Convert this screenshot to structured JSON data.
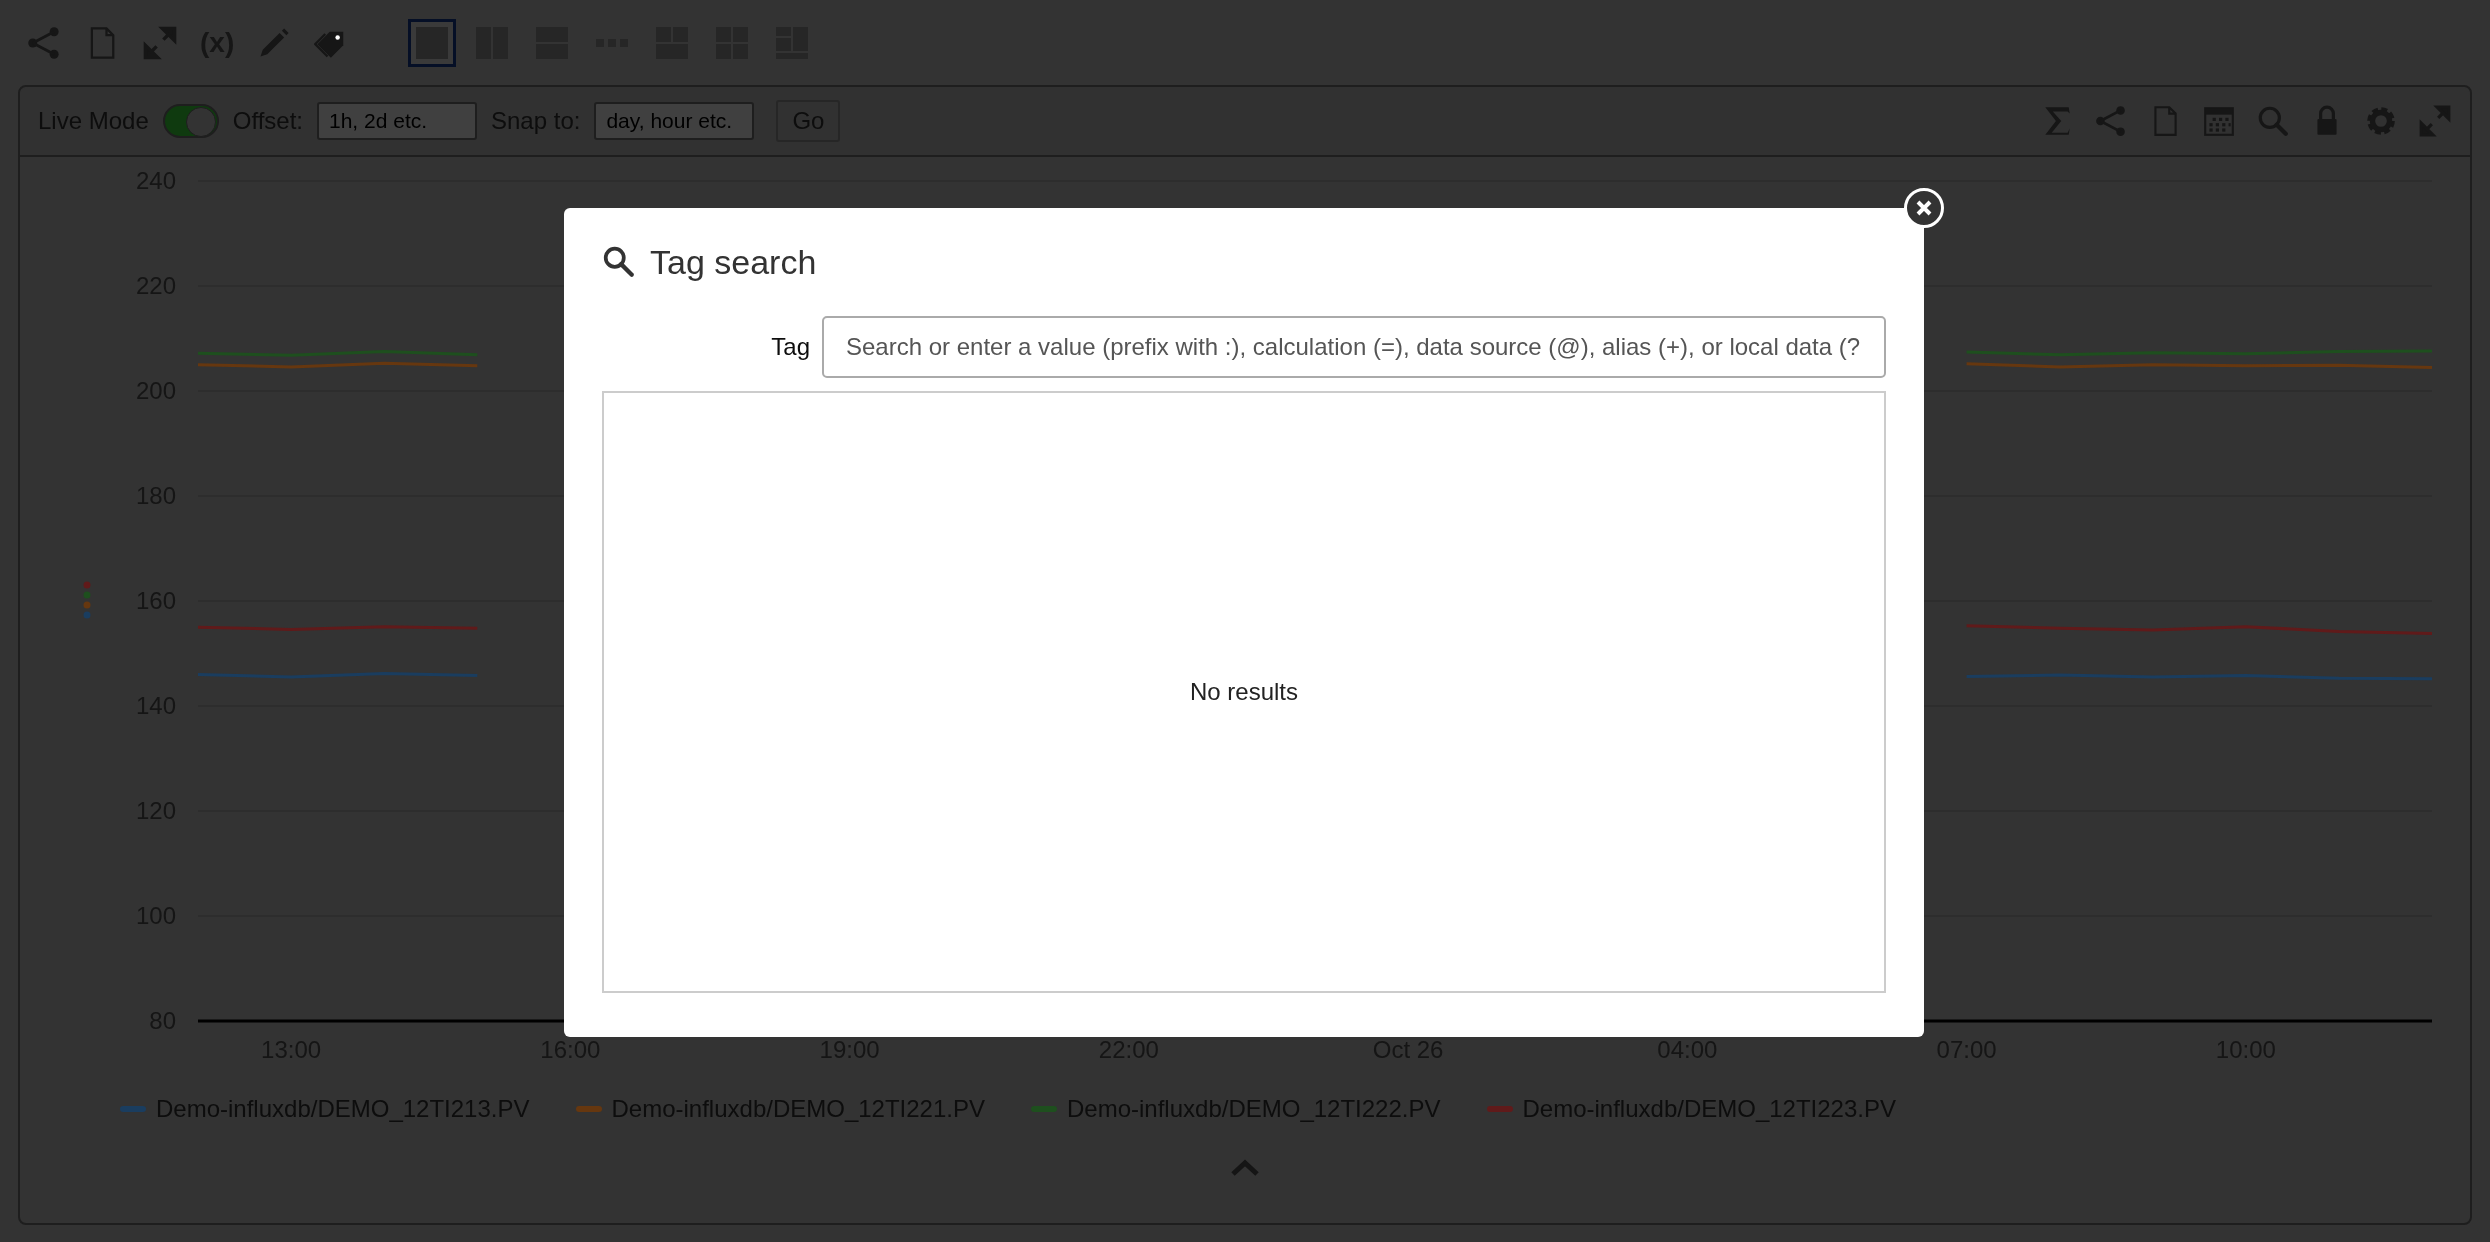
{
  "toolbar": {
    "actions": [
      {
        "kind": "share"
      },
      {
        "kind": "file"
      },
      {
        "kind": "expand"
      },
      {
        "kind": "text",
        "label": "(x)"
      },
      {
        "kind": "pencil"
      },
      {
        "kind": "tags"
      }
    ],
    "layouts": [
      {
        "kind": "single",
        "selected": true
      },
      {
        "kind": "two-columns",
        "selected": false
      },
      {
        "kind": "two-rows",
        "selected": false
      },
      {
        "kind": "many",
        "selected": false
      },
      {
        "kind": "two-top-one-bottom",
        "selected": false
      },
      {
        "kind": "grid",
        "selected": false
      },
      {
        "kind": "mixed",
        "selected": false
      }
    ]
  },
  "panel": {
    "header": {
      "live_mode_label": "Live Mode",
      "live_mode_on": true,
      "offset_label": "Offset:",
      "offset_placeholder": "1h, 2d etc.",
      "snap_label": "Snap to:",
      "snap_placeholder": "day, hour etc.",
      "go_button": "Go",
      "tools": [
        {
          "kind": "sum"
        },
        {
          "kind": "share"
        },
        {
          "kind": "file"
        },
        {
          "kind": "calendar"
        },
        {
          "kind": "search"
        },
        {
          "kind": "lock"
        },
        {
          "kind": "gear"
        },
        {
          "kind": "expand"
        }
      ]
    },
    "chart_data": {
      "type": "line",
      "categories": [
        null,
        "13:00",
        null,
        null,
        "16:00",
        null,
        null,
        "19:00",
        null,
        null,
        "22:00",
        null,
        null,
        "Oct 26",
        null,
        null,
        "04:00",
        null,
        null,
        "07:00",
        null,
        null,
        "10:00",
        null,
        null
      ],
      "ylim": [
        80,
        240
      ],
      "grid": true,
      "yticks": [
        80,
        100,
        120,
        140,
        160,
        180,
        200,
        220,
        240
      ],
      "series": [
        {
          "name": "Demo-influxdb/DEMO_12TI213.PV",
          "color": "#1a3d5f",
          "values": [
            146,
            145.5,
            146.2,
            145.8,
            null,
            null,
            null,
            null,
            null,
            null,
            null,
            null,
            null,
            null,
            null,
            null,
            null,
            null,
            null,
            145.6,
            145.9,
            145.5,
            145.8,
            145.3,
            145.2
          ]
        },
        {
          "name": "Demo-influxdb/DEMO_12TI221.PV",
          "color": "#66370f",
          "values": [
            205,
            204.6,
            205.3,
            204.8,
            null,
            null,
            null,
            null,
            null,
            null,
            null,
            null,
            null,
            null,
            null,
            null,
            null,
            null,
            null,
            205.2,
            204.6,
            205,
            204.8,
            204.9,
            204.5
          ]
        },
        {
          "name": "Demo-influxdb/DEMO_12TI222.PV",
          "color": "#1e4f1e",
          "values": [
            207.2,
            206.8,
            207.5,
            206.9,
            null,
            null,
            null,
            null,
            null,
            null,
            null,
            null,
            null,
            null,
            null,
            null,
            null,
            null,
            null,
            207.4,
            206.9,
            207.3,
            207.1,
            207.5,
            207.6
          ]
        },
        {
          "name": "Demo-influxdb/DEMO_12TI223.PV",
          "color": "#601a1a",
          "values": [
            155,
            154.6,
            155.1,
            154.8,
            null,
            null,
            null,
            null,
            null,
            null,
            null,
            null,
            null,
            null,
            null,
            null,
            null,
            null,
            null,
            155.3,
            154.8,
            154.5,
            155.1,
            154.2,
            153.8
          ]
        }
      ]
    }
  },
  "dialog": {
    "title": "Tag search",
    "tag_label": "Tag",
    "search_placeholder": "Search or enter a value (prefix with :), calculation (=), data source (@), alias (+), or local data (?",
    "empty_message": "No results"
  }
}
